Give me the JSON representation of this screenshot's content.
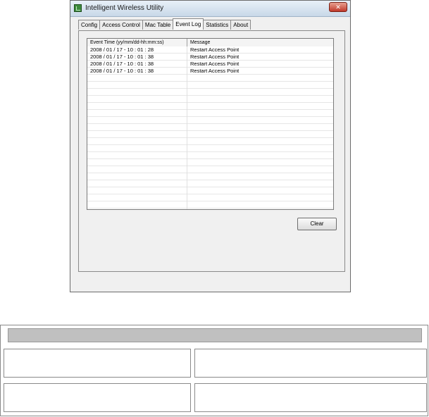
{
  "window": {
    "title": "Intelligent Wireless Utility",
    "close_label": "✕"
  },
  "tabs": [
    {
      "label": "Config",
      "active": false
    },
    {
      "label": "Access Control",
      "active": false
    },
    {
      "label": "Mac Table",
      "active": false
    },
    {
      "label": "Event Log",
      "active": true
    },
    {
      "label": "Statistics",
      "active": false
    },
    {
      "label": "About",
      "active": false
    }
  ],
  "event_log": {
    "columns": [
      "Event Time (yy/mm/dd-hh:mm:ss)",
      "Message"
    ],
    "rows": [
      {
        "time": "2008 / 01 / 17 - 10 : 01 : 28",
        "message": "Restart Access Point"
      },
      {
        "time": "2008 / 01 / 17 - 10 : 01 : 38",
        "message": "Restart Access Point"
      },
      {
        "time": "2008 / 01 / 17 - 10 : 01 : 38",
        "message": "Restart Access Point"
      },
      {
        "time": "2008 / 01 / 17 - 10 : 01 : 38",
        "message": "Restart Access Point"
      }
    ]
  },
  "buttons": {
    "clear": "Clear"
  },
  "colors": {
    "window_bg": "#f0f0f0",
    "close_button": "#c0392b",
    "header_bar": "#c0c0c0"
  }
}
